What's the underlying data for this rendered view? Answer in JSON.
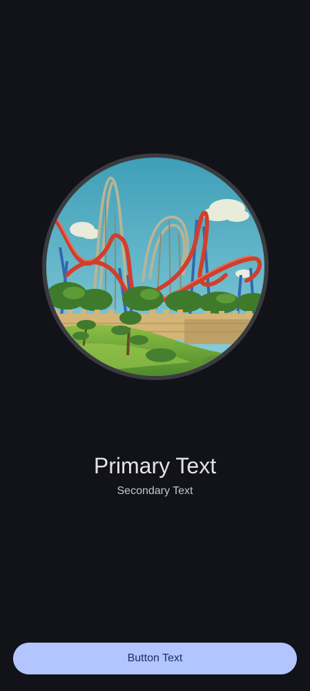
{
  "hero": {
    "image_description": "Circular illustration of roller coasters behind a stone wall with trees",
    "colors": {
      "sky": "#5fb3c9",
      "track_red": "#d8412f",
      "support_blue": "#3a6fb5",
      "track_gray": "#b7b39a",
      "wall": "#d6b87a",
      "grass": "#7faa3c",
      "tree": "#3f7a2c"
    }
  },
  "content": {
    "primary_text": "Primary Text",
    "secondary_text": "Secondary Text"
  },
  "actions": {
    "button_label": "Button Text"
  },
  "theme": {
    "background": "#121318",
    "button_bg": "#b3c5ff",
    "button_fg": "#1b2d60",
    "primary_fg": "#e3e2e9",
    "secondary_fg": "#c5c6d0"
  }
}
